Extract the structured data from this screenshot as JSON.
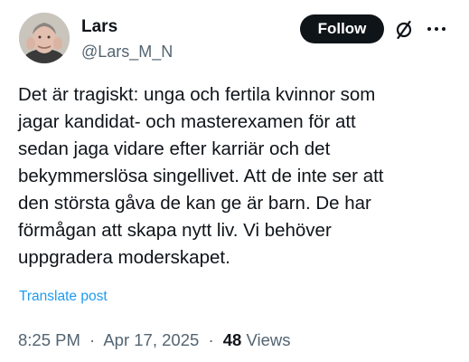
{
  "author": {
    "display_name": "Lars",
    "handle": "@Lars_M_N"
  },
  "actions": {
    "follow_label": "Follow",
    "grok_icon": "slashed-circle-icon",
    "more_icon": "ellipsis-icon"
  },
  "post": {
    "lines": [
      "Det är tragiskt: unga och fertila kvinnor som",
      "jagar kandidat- och masterexamen för att",
      "sedan jaga vidare efter karriär och det",
      "bekymmerslösa singellivet. Att de inte ser att",
      "den största gåva de kan ge är barn. De har",
      "förmågan att skapa nytt liv. Vi behöver",
      "uppgradera moderskapet."
    ],
    "translate_label": "Translate post"
  },
  "meta": {
    "time": "8:25 PM",
    "separator": "·",
    "date": "Apr 17, 2025",
    "views_count": "48",
    "views_label": "Views"
  },
  "colors": {
    "text_primary": "#0f1419",
    "text_secondary": "#536471",
    "link": "#1d9bf0",
    "follow_bg": "#0f1419",
    "follow_text": "#ffffff"
  }
}
